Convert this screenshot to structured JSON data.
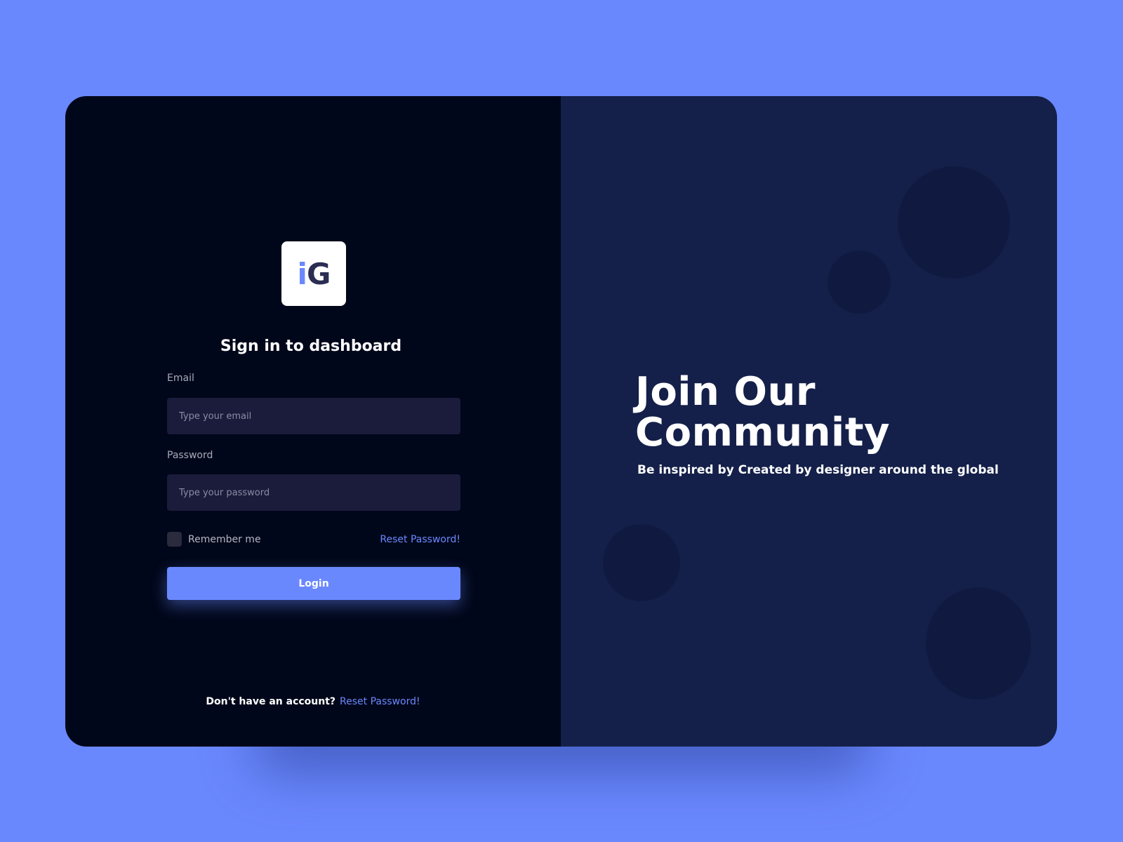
{
  "logo": {
    "letter_i": "i",
    "letter_g": "G"
  },
  "signin": {
    "title": "Sign in to dashboard",
    "email_label": "Email",
    "email_placeholder": "Type your email",
    "email_value": "",
    "password_label": "Password",
    "password_placeholder": "Type your password",
    "password_value": "",
    "remember_label": "Remember me",
    "remember_checked": false,
    "reset_link": "Reset Password!",
    "login_button": "Login"
  },
  "footer": {
    "text": "Don't have an account?",
    "link": "Reset Password!"
  },
  "hero": {
    "title_line1": "Join Our",
    "title_line2": "Community",
    "subtitle": "Be inspired by Created by designer around the global"
  },
  "colors": {
    "background": "#6a88fe",
    "accent": "#6a88fe",
    "left_panel": "#01071a",
    "right_panel": "#142049",
    "input_bg": "#1b1c3b"
  }
}
